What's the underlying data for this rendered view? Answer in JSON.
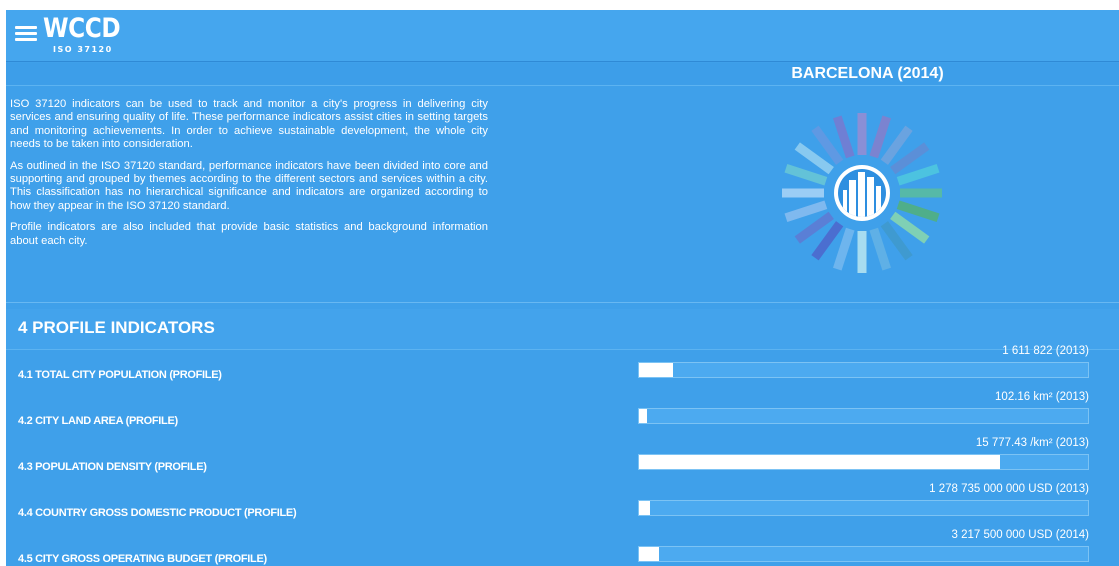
{
  "header": {
    "logo_text": "WCCD",
    "logo_subtext": "ISO 37120",
    "menu_icon": "hamburger-menu-icon"
  },
  "city": {
    "title": "BARCELONA (2014)"
  },
  "intro": {
    "p1": "ISO 37120 indicators can be used to track and monitor a city's progress in delivering city services and ensuring quality of life. These performance indicators assist cities in setting targets and monitoring achievements. In order to achieve sustainable development, the whole city needs to be taken into consideration.",
    "p2": "As outlined in the ISO 37120 standard, performance indicators have been divided into core and supporting and grouped by themes according to the different sectors and services within a city. This classification has no hierarchical significance and indicators are organized according to how they appear in the ISO 37120 standard.",
    "p3": "Profile indicators are also included that provide basic statistics and background information about each city."
  },
  "wheel": {
    "icon": "city-buildings-icon",
    "ray_colors": [
      "#8a8fd6",
      "#7b83d0",
      "#6aa3e0",
      "#5b8fd8",
      "#4cc3e0",
      "#56b9a8",
      "#4fae8a",
      "#7fd0b5",
      "#3f9ad0",
      "#5fb0e6",
      "#a7dcf0",
      "#6eb5ee",
      "#4b6ed0",
      "#5a7fd6",
      "#7fb9ef",
      "#9bcdf5",
      "#63c2d8",
      "#88c9f0",
      "#5f99e3",
      "#6f7fd4"
    ]
  },
  "section": {
    "title": "4 PROFILE INDICATORS"
  },
  "indicators": [
    {
      "label": "4.1 TOTAL CITY POPULATION (PROFILE)",
      "value": "1 611 822 (2013)",
      "bar": 0.075
    },
    {
      "label": "4.2 CITY LAND AREA (PROFILE)",
      "value": "102.16 km² (2013)",
      "bar": 0.018
    },
    {
      "label": "4.3 POPULATION DENSITY (PROFILE)",
      "value": "15 777.43 /km² (2013)",
      "bar": 0.805
    },
    {
      "label": "4.4 COUNTRY GROSS DOMESTIC PRODUCT (PROFILE)",
      "value": "1 278 735 000 000 USD (2013)",
      "bar": 0.025
    },
    {
      "label": "4.5 CITY GROSS OPERATING BUDGET (PROFILE)",
      "value": "3 217 500 000 USD (2014)",
      "bar": 0.045
    }
  ]
}
